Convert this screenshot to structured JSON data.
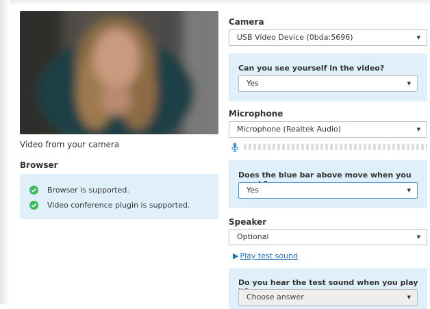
{
  "video": {
    "caption": "Video from your camera"
  },
  "browser": {
    "heading": "Browser",
    "items": [
      {
        "text": "Browser is supported."
      },
      {
        "text": "Video conference plugin is supported."
      }
    ]
  },
  "camera": {
    "heading": "Camera",
    "selected": "USB Video Device (0bda:5696)",
    "question": "Can you see yourself in the video?",
    "answer": "Yes"
  },
  "microphone": {
    "heading": "Microphone",
    "selected": "Microphone (Realtek Audio)",
    "level": 0,
    "question": "Does the blue bar above move when you speak?",
    "answer": "Yes"
  },
  "speaker": {
    "heading": "Speaker",
    "selected": "Optional",
    "play_link": "Play test sound",
    "question": "Do you hear the test sound when you play it?",
    "answer_placeholder": "Choose answer"
  },
  "colors": {
    "panel": "#dff0fa",
    "success": "#3cbb5c",
    "link": "#1e6fb8",
    "mic": "#2f8fd8"
  }
}
